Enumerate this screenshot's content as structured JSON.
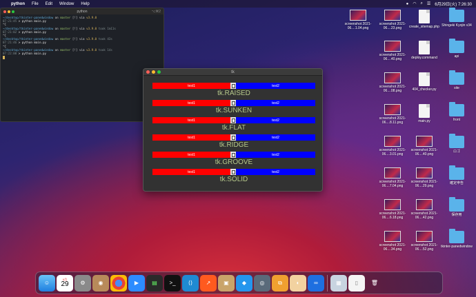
{
  "menubar": {
    "app": "python",
    "items": [
      "File",
      "Edit",
      "Window",
      "Help"
    ],
    "clock": "6月29日(火) 7:26:30"
  },
  "terminal": {
    "title": "python",
    "shortcut": "⌥⌘2",
    "lines": [
      {
        "path": "~/desktop/tkinter-panedwindow",
        "on": " on ",
        "branch": "master",
        "status": " [!] via ",
        "ver": "v3.9.0",
        "took": ""
      },
      {
        "time": "07:21:45",
        "cmd": " > python main.py"
      },
      {
        "plain": "^C"
      },
      {
        "path": "~/desktop/tkinter-panedwindow",
        "on": " on ",
        "branch": "master",
        "status": " [!] via ",
        "ver": "v3.9.0",
        "took": " took 1m11s"
      },
      {
        "time": "07:21:02",
        "cmd": " > python main.py"
      },
      {
        "plain": "^C"
      },
      {
        "path": "~/desktop/tkinter-panedwindow",
        "on": " on ",
        "branch": "master",
        "status": " [!] via ",
        "ver": "v3.9.0",
        "took": " took 43s"
      },
      {
        "time": "07:21:46",
        "cmd": " > python main.py"
      },
      {
        "plain": "^C"
      },
      {
        "path": "~/desktop/tkinter-panedwindow",
        "on": " on ",
        "branch": "master",
        "status": " [!] via ",
        "ver": "v3.9.0",
        "took": " took 14s"
      },
      {
        "time": "07:22:00",
        "cmd": " > python main.py"
      }
    ]
  },
  "tk": {
    "title": "tk",
    "left_label": "test1",
    "right_label": "test2",
    "reliefs": [
      {
        "prefix": "tk.",
        "name": "RAISED"
      },
      {
        "prefix": "tk.",
        "name": "SUNKEN"
      },
      {
        "prefix": "tk.",
        "name": "FLAT"
      },
      {
        "prefix": "tk.",
        "name": "RIDGE"
      },
      {
        "prefix": "tk.",
        "name": "GROOVE"
      },
      {
        "prefix": "tk.",
        "name": "SOLID"
      }
    ]
  },
  "desktop": {
    "icons": [
      {
        "label": "screenshot 2021-06....1.04.png",
        "kind": "shot"
      },
      {
        "label": "screenshot 2021-06....23.png",
        "kind": "shot"
      },
      {
        "label": "create_sitemap.php",
        "kind": "doc"
      },
      {
        "label": "Shingeki Kyojin v34",
        "kind": "folder"
      },
      {
        "label": "screenshot 2021-06....40.png",
        "kind": "shot"
      },
      {
        "label": "deploy.command",
        "kind": "doc"
      },
      {
        "label": "api",
        "kind": "folder"
      },
      {
        "label": "screenshot 2021-06....08.png",
        "kind": "shot"
      },
      {
        "label": "404_checker.py",
        "kind": "doc"
      },
      {
        "label": "site",
        "kind": "folder"
      },
      {
        "label": "screenshot 2021-06....8.11.png",
        "kind": "shot"
      },
      {
        "label": "main.py",
        "kind": "doc"
      },
      {
        "label": "front",
        "kind": "folder"
      },
      {
        "label": "screenshot 2021-06....3.01.png",
        "kind": "shot"
      },
      {
        "label": "screenshot 2021-06....40.png",
        "kind": "shot"
      },
      {
        "label": "ロゴ",
        "kind": "folder"
      },
      {
        "label": "screenshot 2021-06....7.04.png",
        "kind": "shot"
      },
      {
        "label": "screenshot 2021-06....29.png",
        "kind": "shot"
      },
      {
        "label": "確定申告",
        "kind": "folder"
      },
      {
        "label": "screenshot 2021-06....6.18.png",
        "kind": "shot"
      },
      {
        "label": "screenshot 2021-06....42.png",
        "kind": "shot"
      },
      {
        "label": "保存用",
        "kind": "folder"
      },
      {
        "label": "screenshot 2021-06....34.png",
        "kind": "shot"
      },
      {
        "label": "screenshot 2021-06....52.png",
        "kind": "shot"
      },
      {
        "label": "tkinter-panedwindow",
        "kind": "folder"
      }
    ]
  },
  "dock": {
    "calendar_month": "6月",
    "calendar_day": "29"
  },
  "colors": {
    "pane_left": "#ff0000",
    "pane_right": "#0000ff",
    "relief_text": "#b7c98b"
  }
}
